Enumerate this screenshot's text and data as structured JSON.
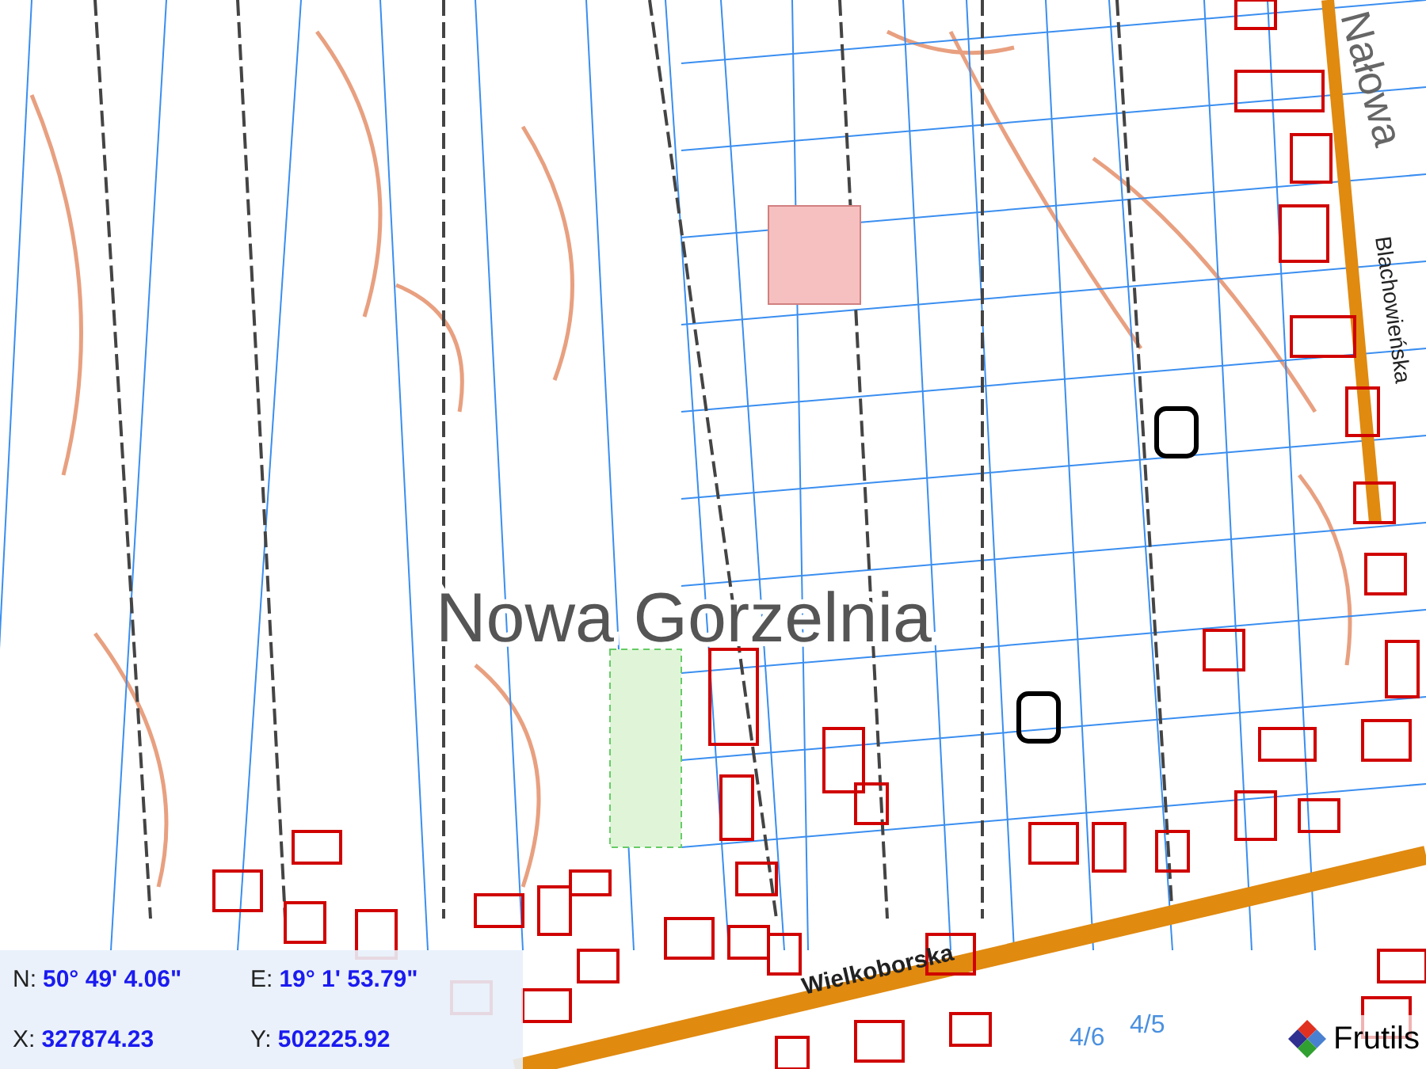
{
  "map": {
    "place_label": "Nowa Gorzelnia",
    "street_labels": [
      {
        "text": "Wielkoborska",
        "kind": "main"
      },
      {
        "text": "Nałowa",
        "kind": "side"
      },
      {
        "text": "Blachowieńska",
        "kind": "small"
      }
    ],
    "parcel_labels": [
      "4/6",
      "4/5"
    ]
  },
  "coordinates": {
    "rows": [
      {
        "label_1": "N:",
        "value_1": "50° 49' 4.06\"",
        "label_2": "E:",
        "value_2": "19° 1' 53.79\""
      },
      {
        "label_1": "X:",
        "value_1": "327874.23",
        "label_2": "Y:",
        "value_2": "502225.92"
      }
    ]
  },
  "logo": {
    "text": "Frutils"
  }
}
